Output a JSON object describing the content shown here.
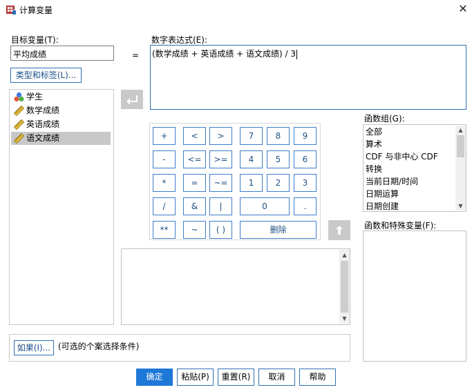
{
  "window": {
    "title": "计算变量",
    "close_glyph": "✕"
  },
  "target": {
    "label": "目标变量(T):",
    "value": "平均成绩"
  },
  "equals": "=",
  "type_label_button": "类型和标签(L)...",
  "variables": [
    {
      "name": "学生",
      "icon": "nominal-icon",
      "selected": false
    },
    {
      "name": "数学成绩",
      "icon": "scale-icon",
      "selected": false
    },
    {
      "name": "英语成绩",
      "icon": "scale-icon",
      "selected": false
    },
    {
      "name": "语文成绩",
      "icon": "scale-icon",
      "selected": true
    }
  ],
  "expression": {
    "label": "数字表达式(E):",
    "value": "(数学成绩 + 英语成绩 + 语文成绩) / 3"
  },
  "keypad": {
    "r1": [
      "+",
      "<",
      ">",
      "7",
      "8",
      "9"
    ],
    "r2": [
      "-",
      "<=",
      ">=",
      "4",
      "5",
      "6"
    ],
    "r3": [
      "*",
      "=",
      "~=",
      "1",
      "2",
      "3"
    ],
    "r4": [
      "/",
      "&",
      "|",
      "0",
      "."
    ],
    "r5": [
      "**",
      "~",
      "( )",
      "删除"
    ]
  },
  "function_group": {
    "label": "函数组(G):",
    "items": [
      "全部",
      "算术",
      "CDF 与非中心 CDF",
      "转换",
      "当前日期/时间",
      "日期运算",
      "日期创建"
    ]
  },
  "functions_label": "函数和特殊变量(F):",
  "if_button": "如果(I)...",
  "if_note": "(可选的个案选择条件)",
  "buttons": {
    "ok": "确定",
    "paste": "粘贴(P)",
    "reset": "重置(R)",
    "cancel": "取消",
    "help": "帮助"
  },
  "colors": {
    "accent": "#1e78d7",
    "border_blue": "#3d7cc9",
    "selection": "#c8c8c8"
  }
}
